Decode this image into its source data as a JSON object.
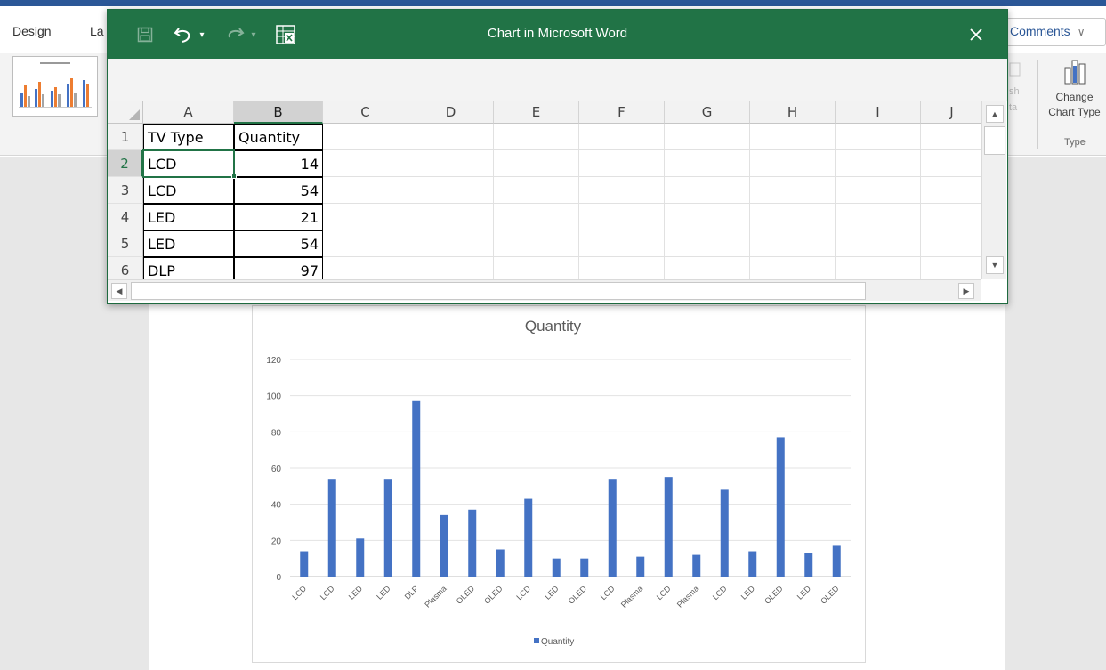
{
  "word": {
    "tabs": [
      "Design",
      "La"
    ],
    "comments_label": "Comments",
    "refresh_ghost": [
      "sh",
      "ta"
    ],
    "change_chart_type_label": "Change",
    "change_chart_type_label2": "Chart Type",
    "group_type_label": "Type"
  },
  "excel": {
    "title": "Chart in Microsoft Word",
    "columns": [
      "A",
      "B",
      "C",
      "D",
      "E",
      "F",
      "G",
      "H",
      "I",
      "J"
    ],
    "rows": [
      {
        "num": "1",
        "a": "TV Type",
        "b": "Quantity"
      },
      {
        "num": "2",
        "a": "LCD",
        "b": "14"
      },
      {
        "num": "3",
        "a": "LCD",
        "b": "54"
      },
      {
        "num": "4",
        "a": "LED",
        "b": "21"
      },
      {
        "num": "5",
        "a": "LED",
        "b": "54"
      },
      {
        "num": "6",
        "a": "DLP",
        "b": "97"
      }
    ],
    "active_cell": "B2"
  },
  "chart_data": {
    "type": "bar",
    "title": "Quantity",
    "categories": [
      "LCD",
      "LCD",
      "LED",
      "LED",
      "DLP",
      "Plasma",
      "OLED",
      "OLED",
      "LCD",
      "LED",
      "OLED",
      "LCD",
      "Plasma",
      "LCD",
      "Plasma",
      "LCD",
      "LED",
      "OLED",
      "LED",
      "OLED"
    ],
    "series": [
      {
        "name": "Quantity",
        "values": [
          14,
          54,
          21,
          54,
          97,
          34,
          37,
          15,
          43,
          10,
          10,
          54,
          11,
          55,
          12,
          48,
          14,
          77,
          13,
          17
        ]
      }
    ],
    "ylim": [
      0,
      120
    ],
    "yticks": [
      "0",
      "20",
      "40",
      "60",
      "80",
      "100",
      "120"
    ],
    "ytick_values": [
      0,
      20,
      40,
      60,
      80,
      100,
      120
    ],
    "grid": true,
    "legend": "bottom",
    "color": "#4472C4"
  }
}
